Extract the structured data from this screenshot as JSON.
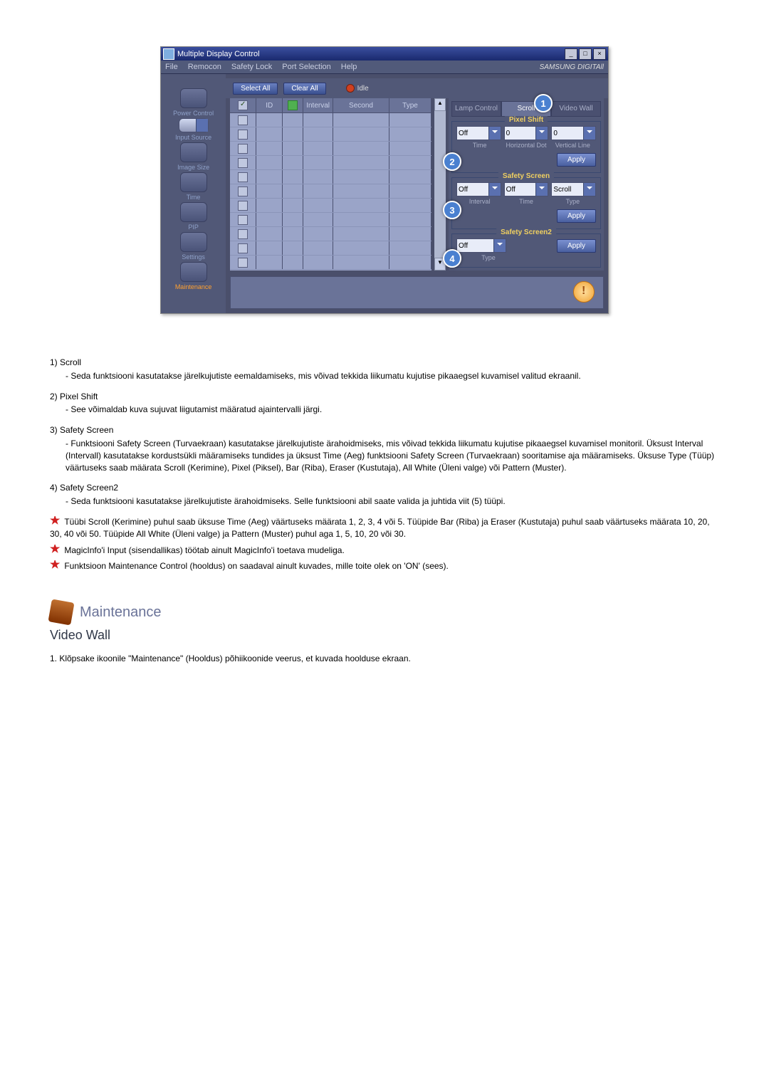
{
  "app": {
    "title": "Multiple Display Control",
    "menu": {
      "file": "File",
      "remocon": "Remocon",
      "safetylock": "Safety Lock",
      "portsel": "Port Selection",
      "help": "Help"
    },
    "brand": "SAMSUNG DIGITAll",
    "sidebar": {
      "power": "Power Control",
      "input": "Input Source",
      "image": "Image Size",
      "time": "Time",
      "pip": "PIP",
      "settings": "Settings",
      "maint": "Maintenance"
    },
    "toolbar": {
      "selectall": "Select All",
      "clearall": "Clear All",
      "idle": "Idle"
    },
    "grid": {
      "id": "ID",
      "interval": "Interval",
      "second": "Second",
      "type": "Type"
    },
    "tabs": {
      "lamp": "Lamp Control",
      "scroll": "Scroll",
      "videowall": "Video Wall"
    },
    "pixelshift": {
      "title": "Pixel Shift",
      "v1": "Off",
      "v2": "0",
      "v3": "0",
      "l1": "Time",
      "l2": "Horizontal Dot",
      "l3": "Vertical Line",
      "apply": "Apply"
    },
    "safety": {
      "title": "Safety Screen",
      "v1": "Off",
      "v2": "Off",
      "v3": "Scroll",
      "l1": "Interval",
      "l2": "Time",
      "l3": "Type",
      "apply": "Apply"
    },
    "safety2": {
      "title": "Safety Screen2",
      "v1": "Off",
      "l1": "Type",
      "apply": "Apply"
    },
    "markers": {
      "m1": "1",
      "m2": "2",
      "m3": "3",
      "m4": "4"
    }
  },
  "doc": {
    "i1": {
      "h": "Scroll",
      "t": "- Seda funktsiooni kasutatakse järelkujutiste eemaldamiseks, mis võivad tekkida liikumatu kujutise pikaaegsel kuvamisel valitud ekraanil."
    },
    "i2": {
      "h": "Pixel Shift",
      "t": "- See võimaldab kuva sujuvat liigutamist määratud ajaintervalli järgi."
    },
    "i3": {
      "h": "Safety Screen",
      "t": "- Funktsiooni Safety Screen (Turvaekraan) kasutatakse järelkujutiste ärahoidmiseks, mis võivad tekkida liikumatu kujutise pikaaegsel kuvamisel monitoril.  Üksust Interval (Intervall) kasutatakse kordustsükli määramiseks tundides ja üksust Time (Aeg) funktsiooni Safety Screen (Turvaekraan) sooritamise aja määramiseks. Üksuse Type (Tüüp) väärtuseks saab määrata Scroll (Kerimine), Pixel (Piksel), Bar (Riba), Eraser (Kustutaja), All White (Üleni valge) või Pattern (Muster)."
    },
    "i4": {
      "h": "Safety Screen2",
      "t": "- Seda funktsiooni kasutatakse järelkujutiste ärahoidmiseks. Selle funktsiooni abil saate valida ja juhtida viit (5) tüüpi."
    },
    "n1": "Tüübi Scroll (Kerimine) puhul saab üksuse Time (Aeg) väärtuseks määrata 1, 2, 3, 4 või 5. Tüüpide Bar (Riba) ja Eraser (Kustutaja) puhul saab väärtuseks määrata 10, 20, 30, 40 või 50. Tüüpide All White (Üleni valge) ja Pattern (Muster) puhul aga 1, 5, 10, 20 või 30.",
    "n2": "MagicInfo'i Input (sisendallikas) töötab ainult MagicInfo'i toetava mudeliga.",
    "n3": "Funktsioon Maintenance Control (hooldus) on saadaval ainult kuvades, mille toite olek on 'ON' (sees).",
    "sec": "Maintenance",
    "sub": "Video Wall",
    "step": "1.  Klõpsake ikoonile \"Maintenance\" (Hooldus) põhiikoonide veerus, et kuvada hoolduse ekraan."
  }
}
